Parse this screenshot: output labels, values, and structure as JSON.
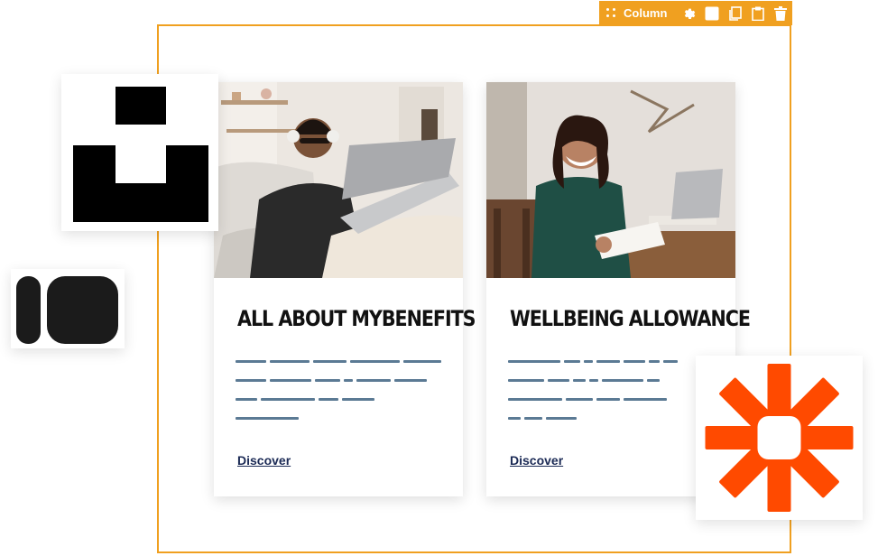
{
  "toolbar": {
    "label": "Column",
    "icons": [
      "drag-handle-icon",
      "gear-icon",
      "square-icon",
      "duplicate-icon",
      "clipboard-icon",
      "trash-icon"
    ]
  },
  "colors": {
    "frame_orange": "#f0a020",
    "placeholder_lines": "#5b7a94",
    "link": "#1b2a55",
    "zapier_orange": "#ff4a00"
  },
  "cards": [
    {
      "title": "ALL ABOUT MYBENEFITS",
      "link": "Discover",
      "image": "man-with-headphones-laptop-photo"
    },
    {
      "title": "WELLBEING ALLOWANCE",
      "link": "Discover",
      "image": "smiling-woman-with-papers-photo"
    }
  ],
  "logos": [
    "unsplash-logo",
    "intercom-logo",
    "zapier-logo"
  ]
}
